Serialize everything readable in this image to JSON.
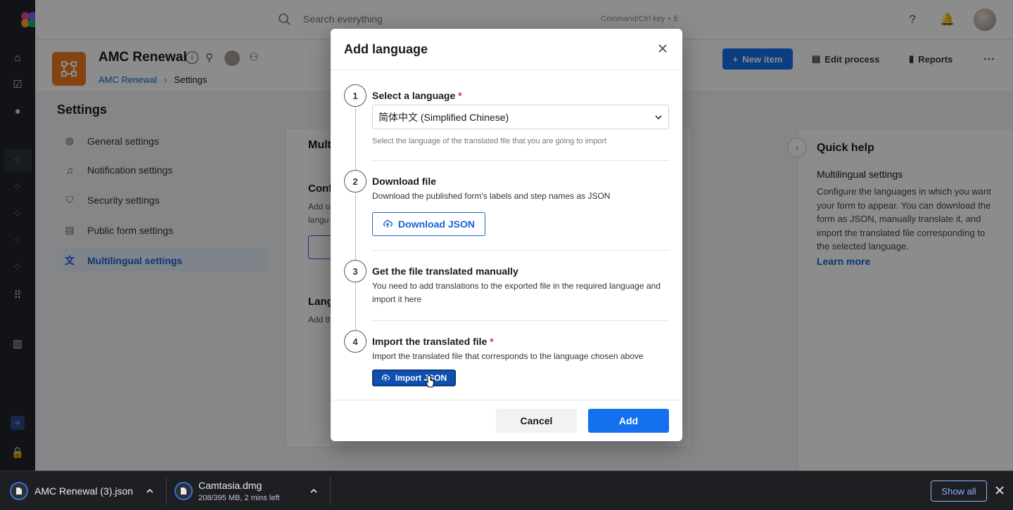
{
  "app": {
    "search_placeholder": "Search everything",
    "search_hint": "Command/Ctrl key + E"
  },
  "header": {
    "title": "AMC Renewal",
    "breadcrumb": [
      "AMC Renewal",
      "Settings"
    ],
    "new_item": "New item",
    "edit_process": "Edit process",
    "reports": "Reports"
  },
  "settings": {
    "title": "Settings",
    "menu": [
      {
        "label": "General settings",
        "icon": "globe-icon"
      },
      {
        "label": "Notification settings",
        "icon": "bell-icon"
      },
      {
        "label": "Security settings",
        "icon": "shield-icon"
      },
      {
        "label": "Public form settings",
        "icon": "form-icon"
      },
      {
        "label": "Multilingual settings",
        "icon": "translate-icon"
      }
    ],
    "panel_fragments": [
      "Multi",
      "Conf",
      "Add o",
      "langu",
      "Lang",
      "Add th"
    ]
  },
  "quick_help": {
    "title": "Quick help",
    "subtitle": "Multilingual settings",
    "body": "Configure the languages in which you want your form to appear. You can download the form as JSON, manually translate it, and import the translated file corresponding to the selected language.",
    "link": "Learn more"
  },
  "modal": {
    "title": "Add language",
    "steps": [
      {
        "num": "1",
        "title": "Select a language",
        "required": true,
        "selected_value": "简体中文 (Simplified Chinese)",
        "hint": "Select the language of the translated file that you are going to import"
      },
      {
        "num": "2",
        "title": "Download file",
        "desc": "Download the published form's labels and step names as JSON",
        "button": "Download JSON"
      },
      {
        "num": "3",
        "title": "Get the file translated manually",
        "desc": "You need to add translations to the exported file in the required language and import it here"
      },
      {
        "num": "4",
        "title": "Import the translated file",
        "required": true,
        "desc": "Import the translated file that corresponds to the language chosen above",
        "button": "Import JSON"
      }
    ],
    "cancel": "Cancel",
    "add": "Add"
  },
  "downloads": {
    "items": [
      {
        "name": "AMC Renewal (3).json",
        "status": ""
      },
      {
        "name": "Camtasia.dmg",
        "status": "208/395 MB, 2 mins left"
      }
    ],
    "show_all": "Show all"
  },
  "colors": {
    "primary": "#1470ef",
    "link": "#1463d6",
    "process_icon": "#f07b1f",
    "required": "#d93025"
  }
}
